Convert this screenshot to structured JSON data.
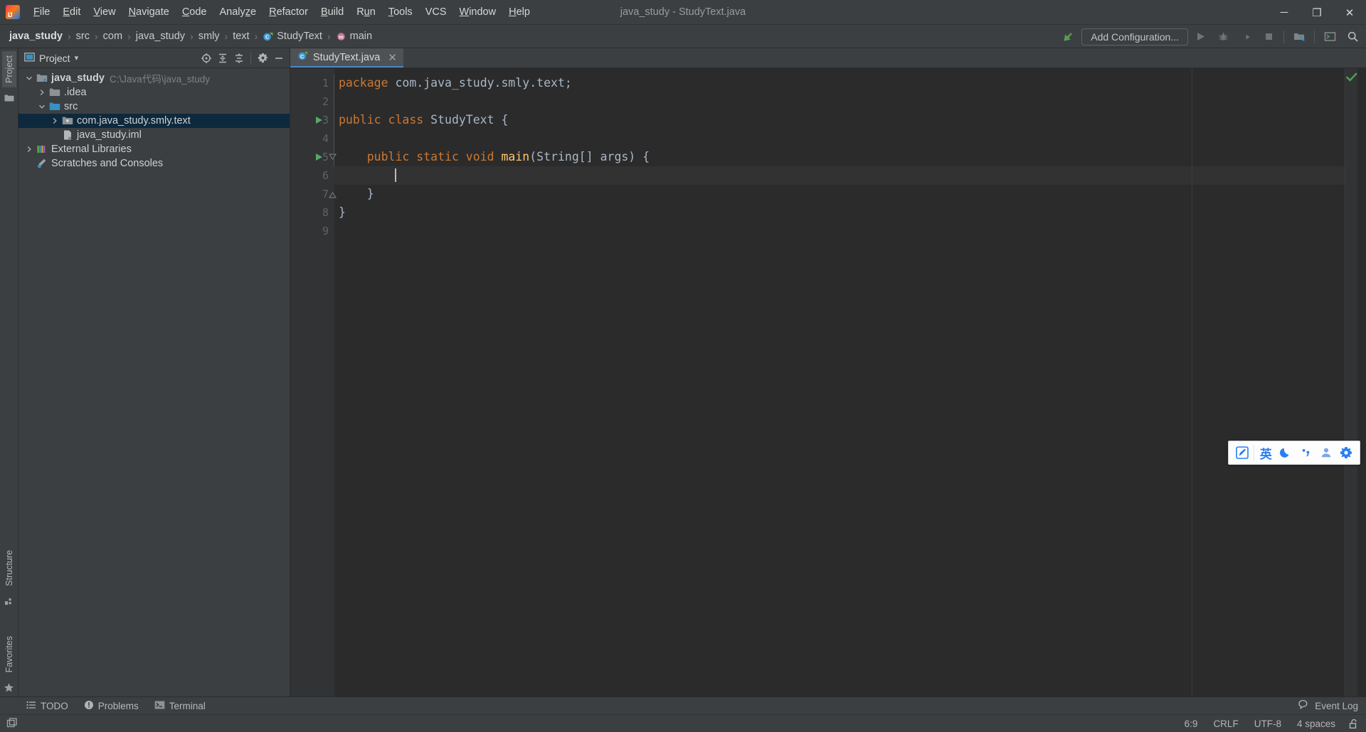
{
  "window": {
    "title": "java_study - StudyText.java",
    "minimize_label": "─",
    "maximize_label": "❐",
    "close_label": "✕"
  },
  "menubar": {
    "items": [
      {
        "label": "File",
        "mnemonic": "F"
      },
      {
        "label": "Edit",
        "mnemonic": "E"
      },
      {
        "label": "View",
        "mnemonic": "V"
      },
      {
        "label": "Navigate",
        "mnemonic": "N"
      },
      {
        "label": "Code",
        "mnemonic": "C"
      },
      {
        "label": "Analyze",
        "mnemonic": "z"
      },
      {
        "label": "Refactor",
        "mnemonic": "R"
      },
      {
        "label": "Build",
        "mnemonic": "B"
      },
      {
        "label": "Run",
        "mnemonic": "u"
      },
      {
        "label": "Tools",
        "mnemonic": "T"
      },
      {
        "label": "VCS",
        "mnemonic": ""
      },
      {
        "label": "Window",
        "mnemonic": "W"
      },
      {
        "label": "Help",
        "mnemonic": "H"
      }
    ]
  },
  "breadcrumb": {
    "separator": "›",
    "items": [
      {
        "label": "java_study",
        "icon": "project-icon",
        "bold": true
      },
      {
        "label": "src",
        "icon": "folder-icon",
        "bold": false
      },
      {
        "label": "com",
        "icon": "folder-icon",
        "bold": false
      },
      {
        "label": "java_study",
        "icon": "folder-icon",
        "bold": false
      },
      {
        "label": "smly",
        "icon": "folder-icon",
        "bold": false
      },
      {
        "label": "text",
        "icon": "folder-icon",
        "bold": false
      },
      {
        "label": "StudyText",
        "icon": "class-icon",
        "bold": false
      },
      {
        "label": "main",
        "icon": "method-icon",
        "bold": false
      }
    ]
  },
  "nav_toolbar": {
    "add_configuration_label": "Add Configuration...",
    "icons": [
      {
        "name": "build-hammer-icon",
        "glyph": "hammer"
      },
      {
        "name": "run-button",
        "glyph": "play"
      },
      {
        "name": "debug-button",
        "glyph": "bug"
      },
      {
        "name": "run-with-coverage-button",
        "glyph": "coverage"
      },
      {
        "name": "stop-button",
        "glyph": "stop"
      },
      {
        "name": "project-structure-button",
        "glyph": "structure"
      },
      {
        "name": "terminal-toggle-button",
        "glyph": "terminal"
      },
      {
        "name": "search-everywhere-button",
        "glyph": "search"
      }
    ]
  },
  "left_rail": {
    "top": [
      {
        "label": "Project",
        "icon": "project-folder-icon",
        "active": true
      }
    ],
    "bottom": [
      {
        "label": "Structure",
        "icon": "structure-icon"
      },
      {
        "label": "Favorites",
        "icon": "star-icon"
      }
    ]
  },
  "project_panel": {
    "title": "Project",
    "dropdown_glyph": "▾",
    "actions": [
      {
        "name": "select-opened-file-icon",
        "tooltip": "Select Opened File"
      },
      {
        "name": "expand-all-icon",
        "tooltip": "Expand All"
      },
      {
        "name": "collapse-all-icon",
        "tooltip": "Collapse All"
      },
      {
        "name": "settings-gear-icon",
        "tooltip": "Settings"
      },
      {
        "name": "hide-panel-icon",
        "tooltip": "Hide"
      }
    ],
    "tree": [
      {
        "label": "java_study",
        "path": "C:\\Java代码\\java_study",
        "indent": 0,
        "twist": "expanded",
        "icon": "project-root-icon",
        "bold": true,
        "selected": false
      },
      {
        "label": ".idea",
        "path": "",
        "indent": 1,
        "twist": "collapsed",
        "icon": "folder-icon",
        "bold": false,
        "selected": false
      },
      {
        "label": "src",
        "path": "",
        "indent": 1,
        "twist": "expanded",
        "icon": "source-folder-icon",
        "bold": false,
        "selected": false
      },
      {
        "label": "com.java_study.smly.text",
        "path": "",
        "indent": 2,
        "twist": "collapsed",
        "icon": "package-icon",
        "bold": false,
        "selected": true
      },
      {
        "label": "java_study.iml",
        "path": "",
        "indent": 2,
        "twist": "none",
        "icon": "iml-file-icon",
        "bold": false,
        "selected": false
      },
      {
        "label": "External Libraries",
        "path": "",
        "indent": 0,
        "twist": "collapsed",
        "icon": "libraries-icon",
        "bold": false,
        "selected": false
      },
      {
        "label": "Scratches and Consoles",
        "path": "",
        "indent": 0,
        "twist": "none",
        "icon": "scratches-icon",
        "bold": false,
        "selected": false
      }
    ]
  },
  "editor": {
    "tabs": [
      {
        "label": "StudyText.java",
        "icon": "java-class-icon",
        "active": true,
        "close_glyph": "✕"
      }
    ],
    "inspection_status": "ok",
    "gutter_lines": [
      "1",
      "2",
      "3",
      "4",
      "5",
      "6",
      "7",
      "8",
      "9"
    ],
    "run_markers": [
      3,
      5
    ],
    "fold_markers": [
      5,
      7
    ],
    "current_line": 6,
    "lines": [
      {
        "n": 1,
        "tokens": [
          {
            "t": "package ",
            "c": "kw"
          },
          {
            "t": "com.java_study.smly.text;",
            "c": "pl"
          }
        ]
      },
      {
        "n": 2,
        "tokens": []
      },
      {
        "n": 3,
        "tokens": [
          {
            "t": "public class ",
            "c": "kw"
          },
          {
            "t": "StudyText {",
            "c": "pl"
          }
        ]
      },
      {
        "n": 4,
        "tokens": []
      },
      {
        "n": 5,
        "tokens": [
          {
            "t": "    public static void ",
            "c": "kw"
          },
          {
            "t": "main",
            "c": "mname"
          },
          {
            "t": "(String[] args) {",
            "c": "pl"
          }
        ]
      },
      {
        "n": 6,
        "tokens": [
          {
            "t": "        ",
            "c": "pl"
          }
        ],
        "caret": true
      },
      {
        "n": 7,
        "tokens": [
          {
            "t": "    }",
            "c": "pl"
          }
        ]
      },
      {
        "n": 8,
        "tokens": [
          {
            "t": "}",
            "c": "pl"
          }
        ]
      },
      {
        "n": 9,
        "tokens": []
      }
    ]
  },
  "bottom_toolbar": {
    "items": [
      {
        "label": "TODO",
        "icon": "todo-list-icon"
      },
      {
        "label": "Problems",
        "icon": "problems-icon"
      },
      {
        "label": "Terminal",
        "icon": "terminal-icon"
      }
    ],
    "event_log_label": "Event Log",
    "event_log_icon": "event-log-icon"
  },
  "statusbar": {
    "toggle_icon": "toggle-toolwindow-icon",
    "caret_position": "6:9",
    "line_separator": "CRLF",
    "encoding": "UTF-8",
    "indent": "4 spaces",
    "lock_icon": "unlocked-icon"
  },
  "ime_bar": {
    "buttons": [
      {
        "name": "ime-logo-icon",
        "glyph": "pen-box",
        "label": ""
      },
      {
        "name": "ime-language-mode",
        "glyph": "text",
        "label": "英"
      },
      {
        "name": "ime-moon-icon",
        "glyph": "moon",
        "label": ""
      },
      {
        "name": "ime-punctuation-icon",
        "glyph": "punct",
        "label": ""
      },
      {
        "name": "ime-user-icon",
        "glyph": "user",
        "label": ""
      },
      {
        "name": "ime-settings-icon",
        "glyph": "gear",
        "label": ""
      }
    ]
  },
  "colors": {
    "accent_blue": "#4a88c7",
    "selection_blue": "#0d293e",
    "keyword_orange": "#cc7832",
    "method_yellow": "#ffc66d",
    "plain_text": "#a9b7c6",
    "editor_bg": "#2b2b2b",
    "chrome_bg": "#3c3f41",
    "run_green": "#499c54",
    "ime_blue": "#2a7ef2"
  }
}
